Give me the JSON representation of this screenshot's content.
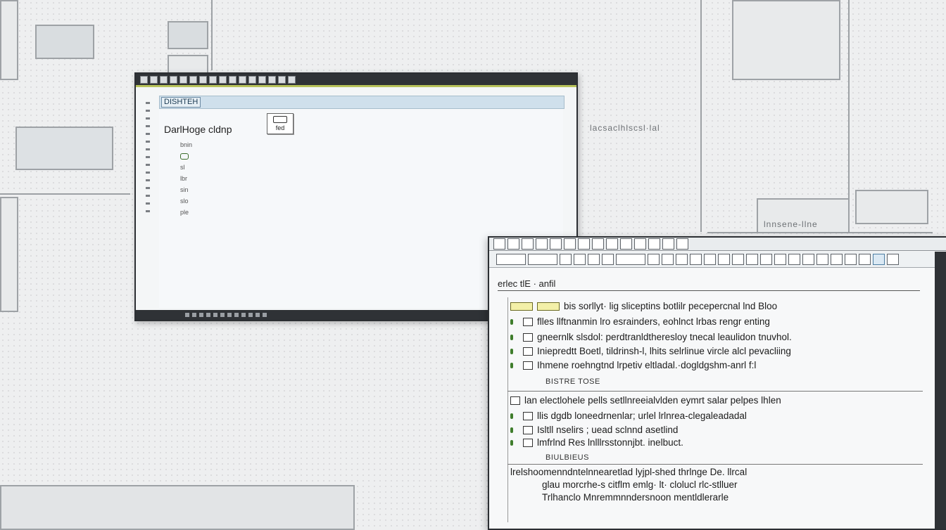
{
  "window_main": {
    "tab_label": "DISHTEH",
    "heading": "DarlHoge cldnp",
    "icon_button_label": "fed",
    "tree_items": [
      "bnin",
      "",
      "sl",
      "lbr",
      "sin",
      "slo",
      "ple"
    ]
  },
  "window_detail": {
    "path_label": "erlec tlE · anfil",
    "rows_group1": [
      "bis sorllyt· lig sliceptins botlilr pecepercnal lnd Bloo",
      "flles llftnanmin lro esrainders, eohlnct lrbas rengr enting",
      "gneernlk slsdol: perdtranldtheresloy tnecal leaulidon tnuvhol.",
      "Iniepredtt Boetl, tildrinsh-l, lhits selrlinue vircle alcl pevacliing",
      "Ihmene roehngtnd lrpetiv eltladal.·dogldgshm-anrl f:l"
    ],
    "group1_caption": "BISTRE TOSE",
    "rows_group2": [
      "lan electlohele pells setllnreeialvlden eymrt salar pelpes lhlen",
      "llis dgdb loneedrnenlar; urlel lrlnrea-clegaleadadal",
      "Isltll nselirs ; uead sclnnd asetlind",
      "lmfrlnd Res lnlllrsstonnjbt. inelbuct."
    ],
    "group2_caption": "BIULBIEUS",
    "rows_group3": [
      "lrelshoomenndntelnnearetlad lyjpl-shed thrlnge De. llrcal",
      "glau morcrhe-s citflm emlg· lt· clolucl rlc-stlluer",
      "Trlhanclo Mnremmnndersnoon mentldlerarle"
    ]
  },
  "background": {
    "label_right": "lacsaclhlscsl·lal",
    "label_panel": "lnnsene-llne"
  }
}
